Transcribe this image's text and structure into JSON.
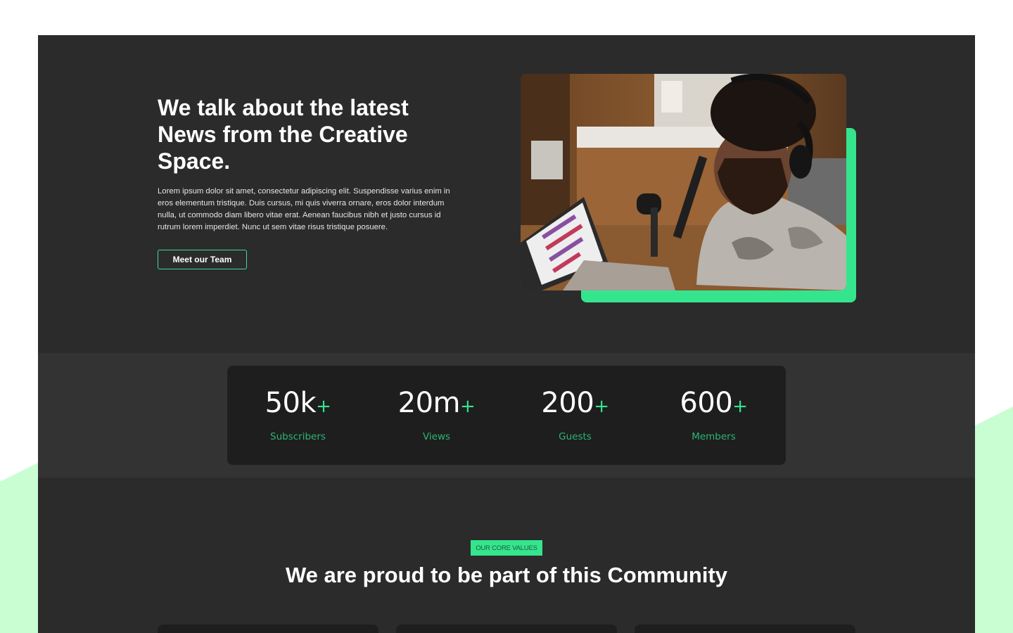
{
  "hero": {
    "title": "We talk about the latest News from the Creative Space.",
    "body": "Lorem ipsum dolor sit amet, consectetur adipiscing elit. Suspendisse varius enim in eros elementum tristique. Duis cursus, mi quis viverra ornare, eros dolor interdum nulla, ut commodo diam libero vitae erat. Aenean faucibus nibh et justo cursus id rutrum lorem imperdiet. Nunc ut sem vitae risus tristique posuere.",
    "cta_label": "Meet our Team"
  },
  "stats": [
    {
      "value": "50k",
      "suffix": "+",
      "label": "Subscribers"
    },
    {
      "value": "20m",
      "suffix": "+",
      "label": "Views"
    },
    {
      "value": "200",
      "suffix": "+",
      "label": "Guests"
    },
    {
      "value": "600",
      "suffix": "+",
      "label": "Members"
    }
  ],
  "values_section": {
    "badge": "OUR CORE VALUES",
    "title": "We are proud to be part of this Community"
  },
  "colors": {
    "accent": "#35e58e",
    "accent_text": "#2bb673",
    "background": "#2b2b2b",
    "card": "#1e1e1e",
    "outer_shape": "#c9fdd2"
  }
}
